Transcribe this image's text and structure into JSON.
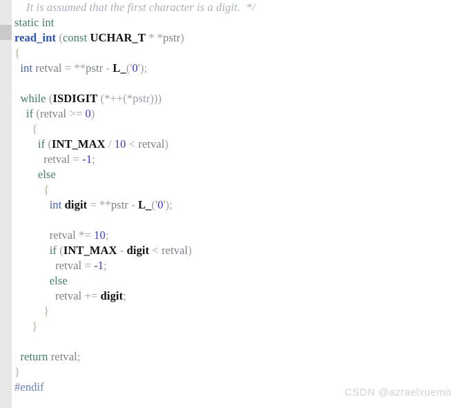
{
  "editor": {
    "gutter": {
      "icon": "change-marker",
      "marker_line_index": 2
    },
    "language": "c",
    "colors": {
      "background": "#ffffff",
      "gutter": "#e7e7e7",
      "gutter_marker": "#c9c9c9",
      "comment": "#a8b0c0",
      "keyword": "#3f7f5f",
      "type": "#3f60b5",
      "function": "#2a52be",
      "macro": "#111111",
      "variable": "#7a7f8a",
      "number": "#3535cf",
      "string": "#c08040",
      "punctuation": "#9aa0ab",
      "preprocessor": "#6b7fb5",
      "watermark": "#d2d2d2"
    }
  },
  "code": {
    "line_01": {
      "comment": "It is assumed that the first character is a digit.",
      "comment_close": "*/"
    },
    "line_02": {
      "static": "static",
      "int": "int"
    },
    "line_03": {
      "name": "read_int",
      "open": "(",
      "const": "const",
      "type": "UCHAR_T",
      "star1": "*",
      "star2": "*",
      "param": "pstr",
      "close": ")"
    },
    "line_04": {
      "brace": "{"
    },
    "line_05": {
      "int": "int",
      "var": "retval",
      "eq": "=",
      "deref": "**",
      "pstr": "pstr",
      "minus": "-",
      "macro": "L_",
      "open": "(",
      "quote_open": "'",
      "zero": "0",
      "quote_close": "'",
      "close": ")",
      "semi": ";"
    },
    "line_07": {
      "while": "while",
      "open": "(",
      "macro": "ISDIGIT",
      "expr": "(*++(*pstr)))"
    },
    "line_08": {
      "if": "if",
      "open": "(",
      "var": "retval",
      "op": ">=",
      "num": "0",
      "close": ")"
    },
    "line_09": {
      "brace": "{"
    },
    "line_10": {
      "if": "if",
      "open": "(",
      "macro": "INT_MAX",
      "slash": "/",
      "num": "10",
      "lt": "<",
      "var": "retval",
      "close": ")"
    },
    "line_11": {
      "var": "retval",
      "eq": "=",
      "num": "-1",
      "semi": ";"
    },
    "line_12": {
      "else": "else"
    },
    "line_13": {
      "brace": "{"
    },
    "line_14": {
      "int": "int",
      "var": "digit",
      "eq": "=",
      "deref": "**",
      "pstr": "pstr",
      "minus": "-",
      "macro": "L_",
      "open": "(",
      "quote_open": "'",
      "zero": "0",
      "quote_close": "'",
      "close": ")",
      "semi": ";"
    },
    "line_16": {
      "var": "retval",
      "op": "*=",
      "num": "10",
      "semi": ";"
    },
    "line_17": {
      "if": "if",
      "open": "(",
      "macro": "INT_MAX",
      "minus": "-",
      "var": "digit",
      "lt": "<",
      "var2": "retval",
      "close": ")"
    },
    "line_18": {
      "var": "retval",
      "eq": "=",
      "num": "-1",
      "semi": ";"
    },
    "line_19": {
      "else": "else"
    },
    "line_20": {
      "var": "retval",
      "op": "+=",
      "var2": "digit",
      "semi": ";"
    },
    "line_21": {
      "brace": "}"
    },
    "line_22": {
      "brace": "}"
    },
    "line_24": {
      "return": "return",
      "var": "retval",
      "semi": ";"
    },
    "line_25": {
      "brace": "}"
    },
    "line_26": {
      "pp": "#endif"
    }
  },
  "watermark": {
    "text": "CSDN @azraelxuemo"
  }
}
